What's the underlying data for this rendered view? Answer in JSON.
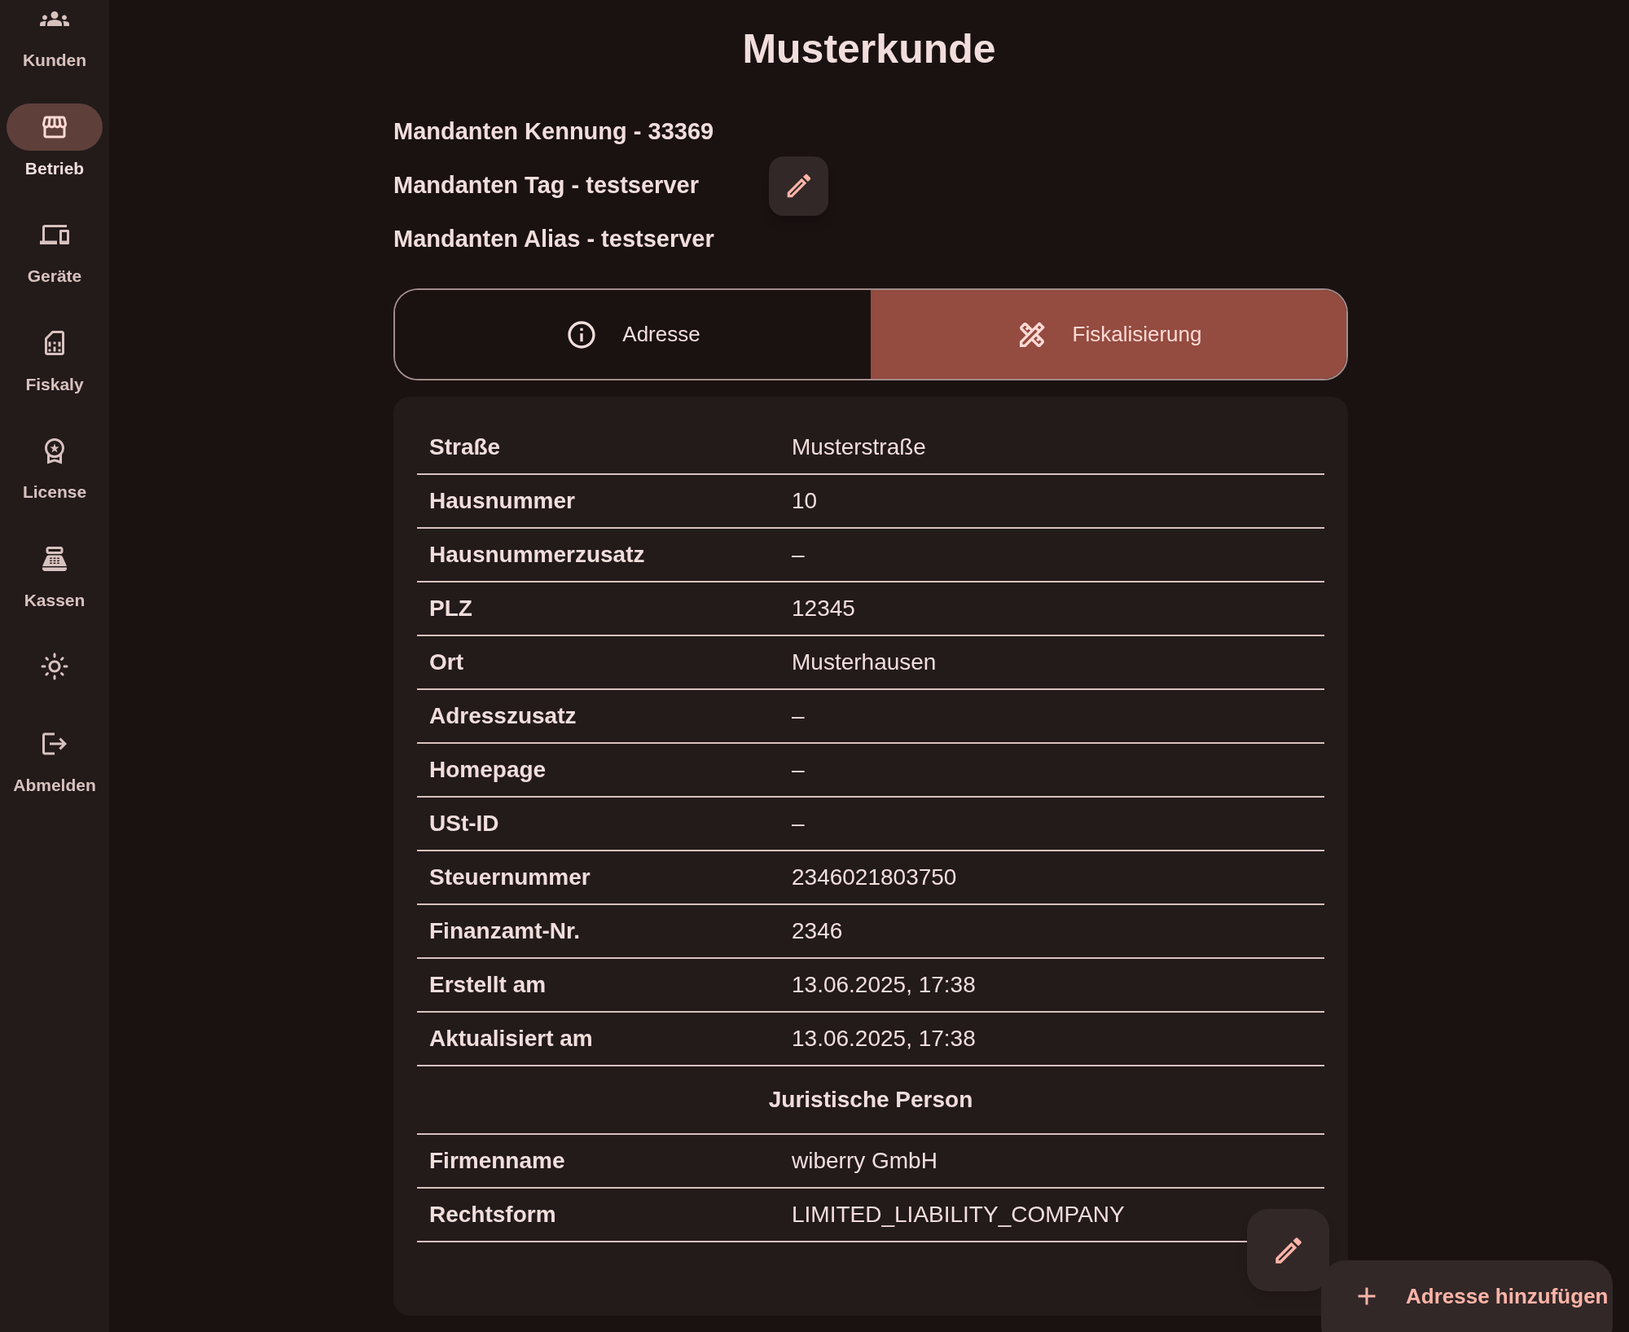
{
  "sidebar": {
    "items": [
      {
        "label": "Kunden",
        "selected": false
      },
      {
        "label": "Betrieb",
        "selected": true
      },
      {
        "label": "Geräte",
        "selected": false
      },
      {
        "label": "Fiskaly",
        "selected": false
      },
      {
        "label": "License",
        "selected": false
      },
      {
        "label": "Kassen",
        "selected": false
      },
      {
        "selected": false
      },
      {
        "label": "Abmelden",
        "selected": false
      }
    ]
  },
  "title": "Musterkunde",
  "info_lines": [
    {
      "text": "Mandanten Kennung - 33369",
      "editable": false
    },
    {
      "text": "Mandanten Tag - testserver",
      "editable": true
    },
    {
      "text": "Mandanten Alias - testserver",
      "editable": false
    }
  ],
  "tabs": [
    {
      "label": "Adresse",
      "selected": false
    },
    {
      "label": "Fiskalisierung",
      "selected": true
    }
  ],
  "details": [
    {
      "kind": "row",
      "label": "Straße",
      "value": "Musterstraße"
    },
    {
      "kind": "row",
      "label": "Hausnummer",
      "value": "10"
    },
    {
      "kind": "row",
      "label": "Hausnummerzusatz",
      "value": "–"
    },
    {
      "kind": "row",
      "label": "PLZ",
      "value": "12345"
    },
    {
      "kind": "row",
      "label": "Ort",
      "value": "Musterhausen"
    },
    {
      "kind": "row",
      "label": "Adresszusatz",
      "value": "–"
    },
    {
      "kind": "row",
      "label": "Homepage",
      "value": "–"
    },
    {
      "kind": "row",
      "label": "USt-ID",
      "value": "–"
    },
    {
      "kind": "row",
      "label": "Steuernummer",
      "value": "2346021803750"
    },
    {
      "kind": "row",
      "label": "Finanzamt-Nr.",
      "value": "2346"
    },
    {
      "kind": "row",
      "label": "Erstellt am",
      "value": "13.06.2025, 17:38"
    },
    {
      "kind": "row",
      "label": "Aktualisiert am",
      "value": "13.06.2025, 17:38"
    },
    {
      "kind": "section",
      "label": "Juristische Person"
    },
    {
      "kind": "row",
      "label": "Firmenname",
      "value": "wiberry GmbH"
    },
    {
      "kind": "row",
      "label": "Rechtsform",
      "value": "LIMITED_LIABILITY_COMPANY"
    }
  ],
  "add_button": {
    "label": "Adresse hinzufügen"
  }
}
